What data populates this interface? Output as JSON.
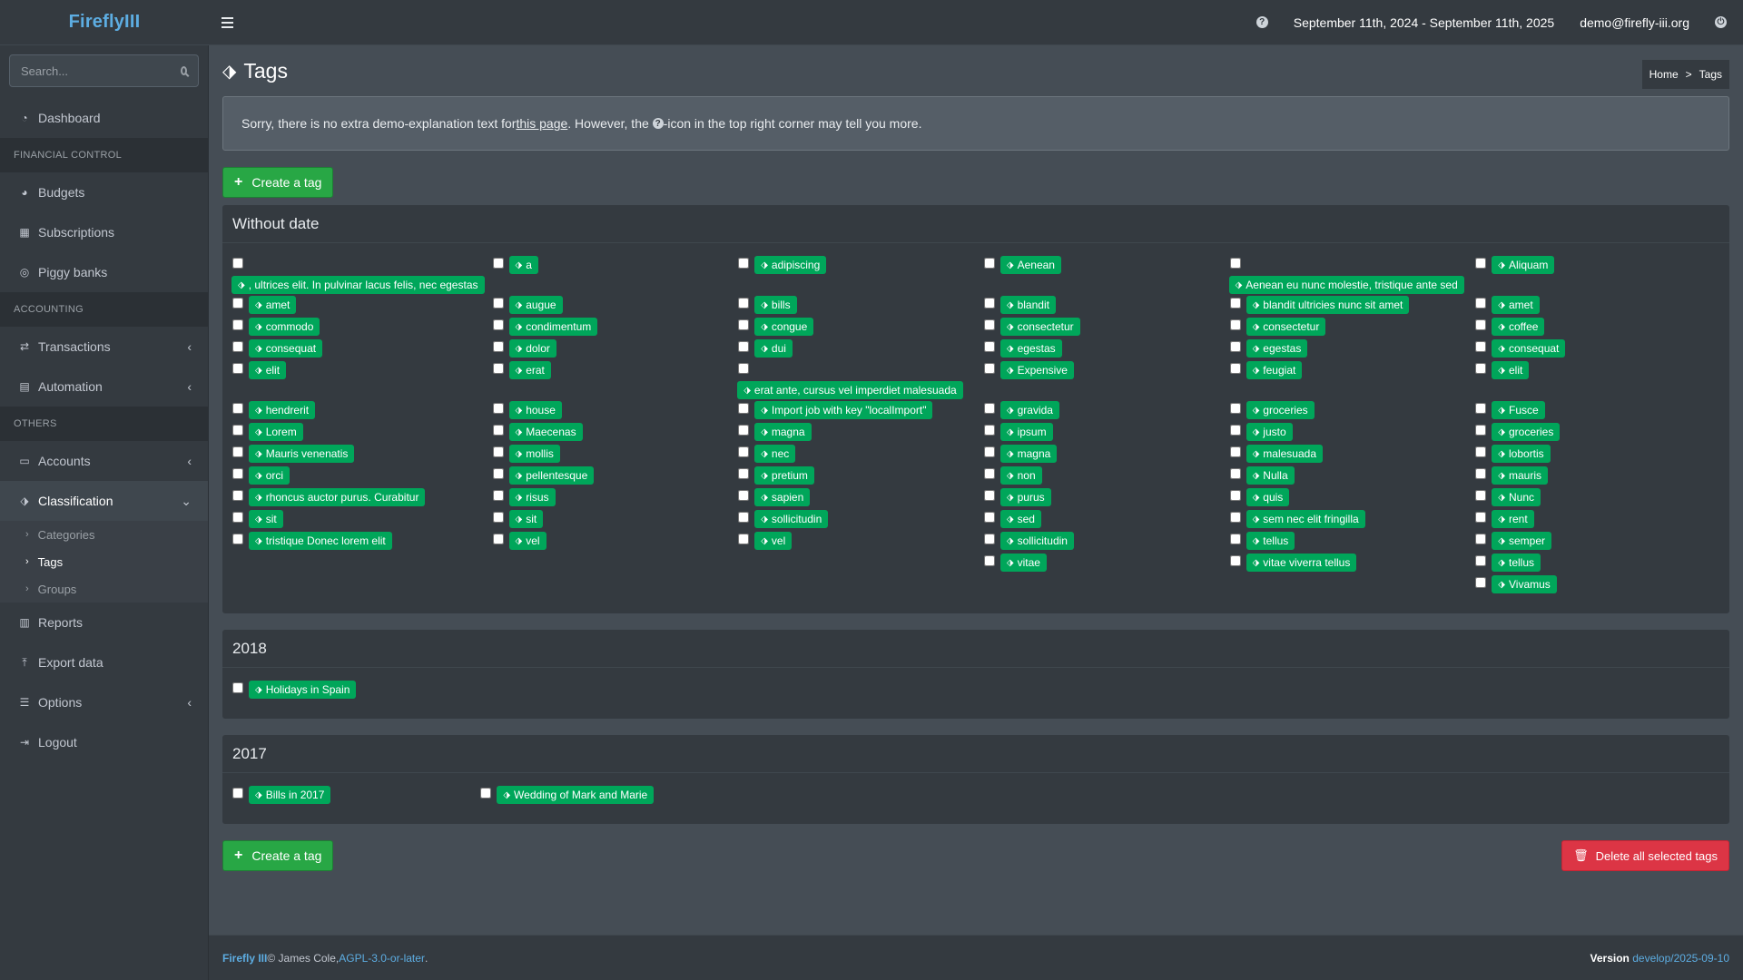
{
  "app": {
    "brand": "FireflyIII",
    "date_range": "September 11th, 2024 - September 11th, 2025",
    "user": "demo@firefly-iii.org"
  },
  "search": {
    "placeholder": "Search..."
  },
  "sidebar": {
    "dashboard": "Dashboard",
    "header_financial": "Financial control",
    "budgets": "Budgets",
    "subscriptions": "Subscriptions",
    "piggy": "Piggy banks",
    "header_accounting": "Accounting",
    "transactions": "Transactions",
    "automation": "Automation",
    "header_others": "Others",
    "accounts": "Accounts",
    "classification": "Classification",
    "sub": [
      "Categories",
      "Tags",
      "Groups"
    ],
    "reports": "Reports",
    "export": "Export data",
    "options": "Options",
    "logout": "Logout"
  },
  "page": {
    "title": "Tags",
    "breadcrumb_home": "Home",
    "breadcrumb_sep": ">",
    "breadcrumb_current": "Tags",
    "callout_before": "Sorry, there is no extra demo-explanation text for ",
    "callout_link": "this page",
    "callout_after": ". However, the ",
    "callout_end": "-icon in the top right corner may tell you more.",
    "create_label": "Create a tag",
    "delete_label": "Delete all selected tags"
  },
  "groups": [
    {
      "title": "Without date",
      "tags": [
        ", ultrices elit. In pulvinar lacus felis, nec egestas",
        "a",
        "adipiscing",
        "Aenean",
        "Aenean eu nunc molestie, tristique ante sed",
        "Aliquam",
        "amet",
        "augue",
        "bills",
        "blandit",
        "blandit ultricies nunc sit amet",
        "amet",
        "commodo",
        "condimentum",
        "congue",
        "consectetur",
        "consectetur",
        "coffee",
        "consequat",
        "dolor",
        "dui",
        "egestas",
        "egestas",
        "consequat",
        "elit",
        "erat",
        "erat ante, cursus vel imperdiet malesuada",
        "Expensive",
        "feugiat",
        "elit",
        "hendrerit",
        "house",
        "Import job with key \"localImport\"",
        "gravida",
        "groceries",
        "Fusce",
        "Lorem",
        "Maecenas",
        "magna",
        "ipsum",
        "justo",
        "groceries",
        "Mauris venenatis",
        "mollis",
        "nec",
        "magna",
        "malesuada",
        "lobortis",
        "orci",
        "pellentesque",
        "pretium",
        "non",
        "Nulla",
        "mauris",
        "rhoncus auctor purus. Curabitur",
        "risus",
        "sapien",
        "purus",
        "quis",
        "Nunc",
        "sit",
        "sit",
        "sollicitudin",
        "sed",
        "sem nec elit fringilla",
        "rent",
        "tristique Donec lorem elit",
        "vel",
        "vel",
        "sollicitudin",
        "tellus",
        "semper",
        "",
        "",
        "",
        "vitae",
        "vitae viverra tellus",
        "tellus",
        "",
        "",
        "",
        "",
        "",
        "Vivamus"
      ]
    },
    {
      "title": "2018",
      "tags": [
        "Holidays in Spain"
      ]
    },
    {
      "title": "2017",
      "tags": [
        "Bills in 2017",
        "Wedding of Mark and Marie"
      ]
    }
  ],
  "footer": {
    "brand": "Firefly III",
    "copyright": " © James Cole, ",
    "license": "AGPL-3.0-or-later",
    "period": ".",
    "version_label": "Version",
    "version": "develop/2025-09-10"
  },
  "colors": {
    "tag": "#00a65a",
    "brand": "#5dade2",
    "danger": "#dc3545",
    "success": "#28a745"
  }
}
